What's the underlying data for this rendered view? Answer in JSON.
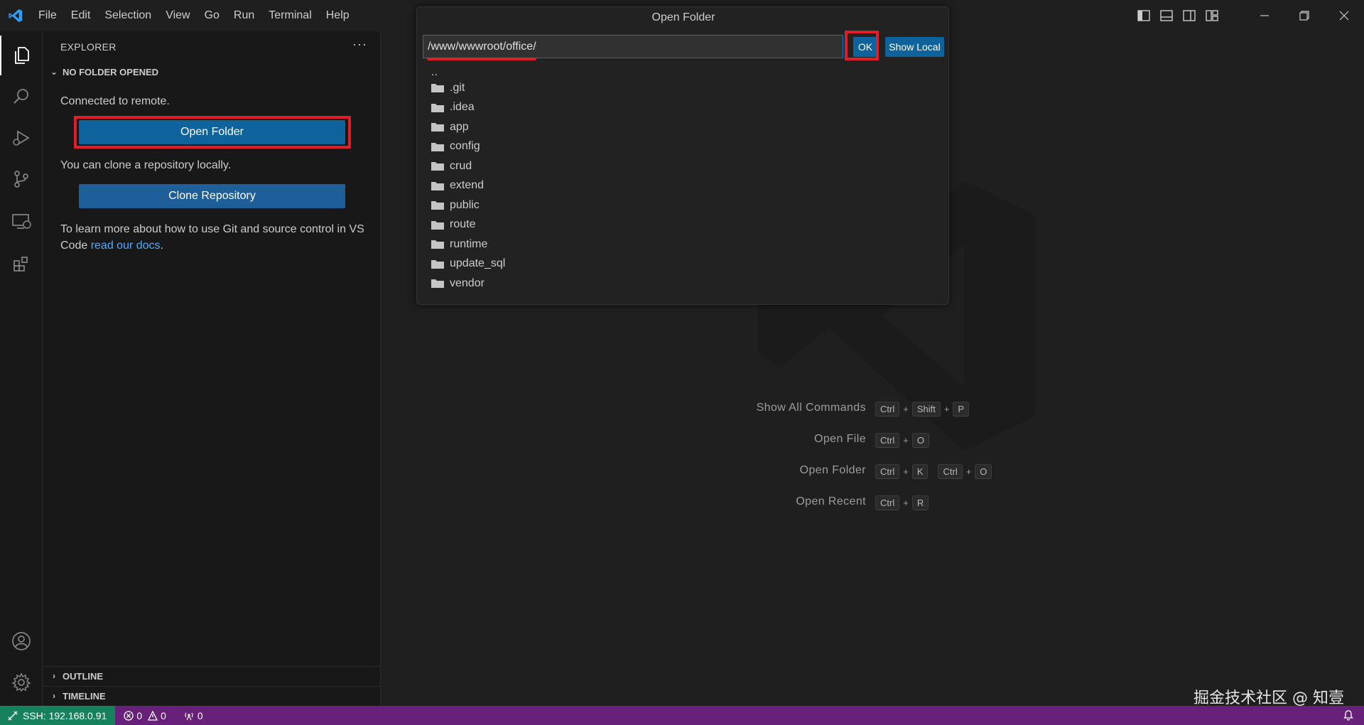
{
  "menu": [
    "File",
    "Edit",
    "Selection",
    "View",
    "Go",
    "Run",
    "Terminal",
    "Help"
  ],
  "sidebar": {
    "header": "EXPLORER",
    "more": "···",
    "section_title": "NO FOLDER OPENED",
    "connected_text": "Connected to remote.",
    "open_folder_label": "Open Folder",
    "clone_text": "You can clone a repository locally.",
    "clone_label": "Clone Repository",
    "learn_text": "To learn more about how to use Git and source control in VS Code ",
    "learn_link": "read our docs",
    "learn_end": ".",
    "outline": "OUTLINE",
    "timeline": "TIMELINE"
  },
  "quickpick": {
    "title": "Open Folder",
    "input_value": "/www/wwwroot/office/",
    "ok_label": "OK",
    "show_local_label": "Show Local",
    "parent": "..",
    "items": [
      ".git",
      ".idea",
      "app",
      "config",
      "crud",
      "extend",
      "public",
      "route",
      "runtime",
      "update_sql",
      "vendor"
    ]
  },
  "shortcuts": [
    {
      "label": "Show All Commands",
      "keys": [
        [
          "Ctrl",
          "Shift",
          "P"
        ]
      ]
    },
    {
      "label": "Open File",
      "keys": [
        [
          "Ctrl",
          "O"
        ]
      ]
    },
    {
      "label": "Open Folder",
      "keys": [
        [
          "Ctrl",
          "K"
        ],
        [
          "Ctrl",
          "O"
        ]
      ]
    },
    {
      "label": "Open Recent",
      "keys": [
        [
          "Ctrl",
          "R"
        ]
      ]
    }
  ],
  "status": {
    "remote": "SSH: 192.168.0.91",
    "errors": "0",
    "warnings": "0",
    "ports": "0"
  },
  "watermark_text": "掘金技术社区 @ 知壹",
  "colors": {
    "accent": "#0e639c",
    "statusbar": "#68217a",
    "remote": "#16825d",
    "highlight": "#e01e2a",
    "link": "#4daafc"
  }
}
